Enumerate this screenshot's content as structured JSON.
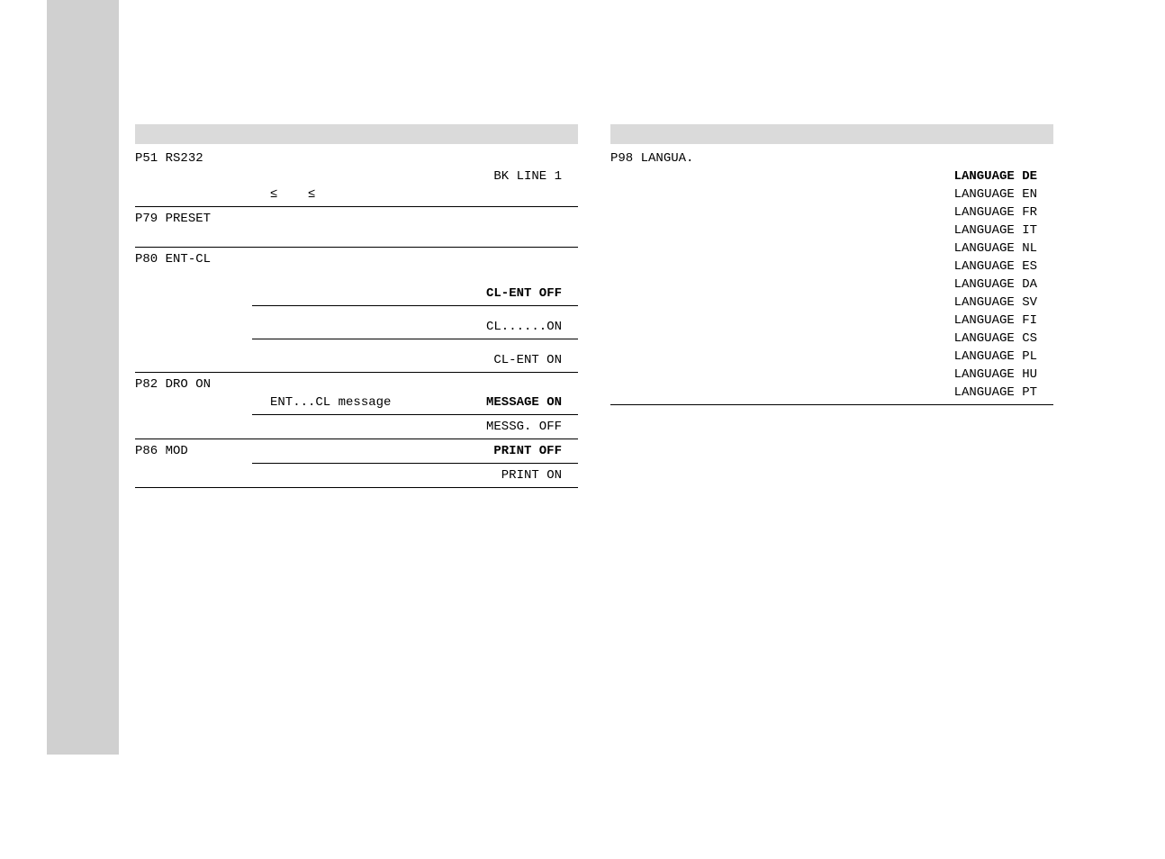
{
  "left": {
    "p51": {
      "code": "P51",
      "name": "RS232"
    },
    "p51_val": "BK LINE 1",
    "leq1": "≤",
    "leq2": "≤",
    "p79": {
      "code": "P79",
      "name": "PRESET"
    },
    "p80": {
      "code": "P80",
      "name": "ENT-CL"
    },
    "p80_v1": "CL-ENT OFF",
    "p80_v2": "CL......ON",
    "p80_v3": "CL-ENT ON",
    "p82": {
      "code": "P82",
      "name": "DRO ON"
    },
    "p82_desc": "ENT...CL message",
    "p82_v1": "MESSAGE ON",
    "p82_v2": "MESSG. OFF",
    "p86": {
      "code": "P86",
      "name": "MOD"
    },
    "p86_v1": "PRINT OFF",
    "p86_v2": "PRINT ON"
  },
  "right": {
    "p98": {
      "code": "P98",
      "name": "LANGUA."
    },
    "langs": [
      {
        "label": "LANGUAGE DE",
        "bold": true
      },
      {
        "label": "LANGUAGE EN"
      },
      {
        "label": "LANGUAGE FR"
      },
      {
        "label": "LANGUAGE IT"
      },
      {
        "label": "LANGUAGE NL"
      },
      {
        "label": "LANGUAGE ES"
      },
      {
        "label": "LANGUAGE DA"
      },
      {
        "label": "LANGUAGE SV"
      },
      {
        "label": "LANGUAGE FI"
      },
      {
        "label": "LANGUAGE CS"
      },
      {
        "label": "LANGUAGE PL"
      },
      {
        "label": "LANGUAGE HU"
      },
      {
        "label": "LANGUAGE PT"
      }
    ]
  }
}
